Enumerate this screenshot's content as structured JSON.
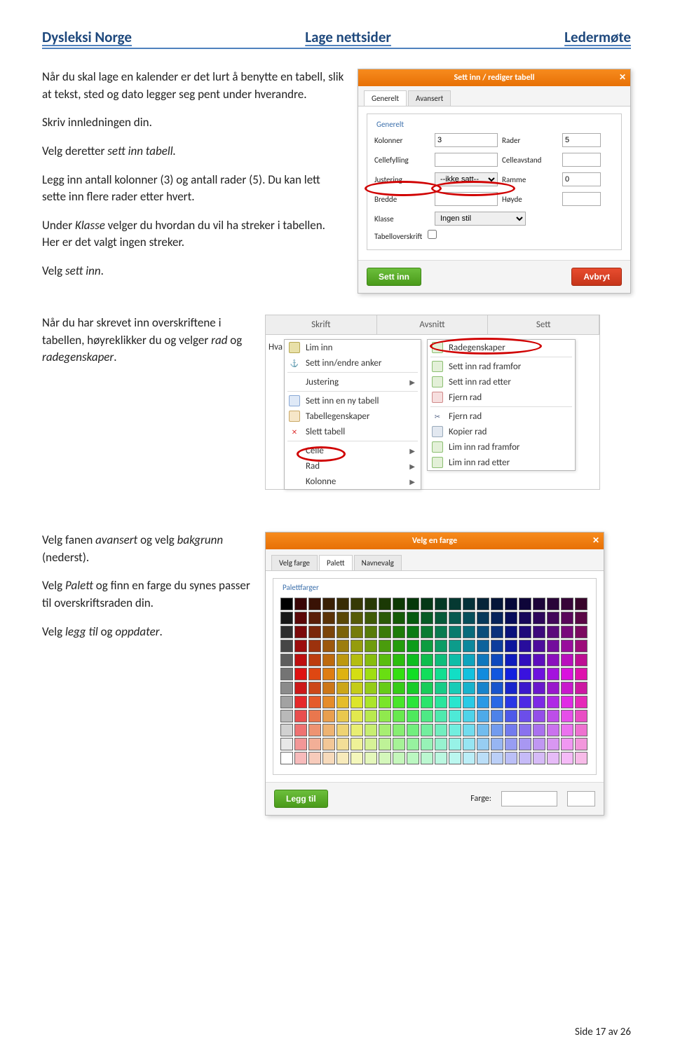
{
  "header": {
    "left": "Dysleksi Norge",
    "center": "Lage nettsider",
    "right": "Ledermøte"
  },
  "intro": {
    "p1": "Når du skal lage en kalender er det lurt å benytte en tabell, slik at tekst, sted og dato legger seg pent under hverandre.",
    "p2": "Skriv innledningen din.",
    "p3a": "Velg deretter ",
    "p3b": "sett inn tabell.",
    "p4": "Legg inn antall kolonner (3) og antall rader (5). Du kan lett sette inn flere rader etter hvert.",
    "p5a": "Under ",
    "p5b": "Klasse",
    "p5c": " velger du hvordan du vil ha streker i tabellen. Her er det valgt ingen streker.",
    "p6a": "Velg ",
    "p6b": "sett inn",
    "p6c": "."
  },
  "block2": {
    "p1a": "Når du har skrevet inn overskriftene i tabellen, høyreklikker du og velger ",
    "p1b": "rad",
    "p1c": " og ",
    "p1d": "radegenskaper",
    "p1e": "."
  },
  "block3": {
    "p1a": "Velg fanen ",
    "p1b": "avansert",
    "p1c": " og velg ",
    "p1d": "bakgrunn ",
    "p1e": "(nederst).",
    "p2a": "Velg ",
    "p2b": "Palett",
    "p2c": " og finn en farge du synes passer til overskriftsraden din.",
    "p3a": "Velg ",
    "p3b": "legg til",
    "p3c": " og ",
    "p3d": "oppdater",
    "p3e": "."
  },
  "dialog1": {
    "title": "Sett inn / rediger tabell",
    "tab_general": "Generelt",
    "tab_advanced": "Avansert",
    "legend": "Generelt",
    "labels": {
      "kolonner": "Kolonner",
      "rader": "Rader",
      "cellefylling": "Cellefylling",
      "celleavstand": "Celleavstand",
      "justering": "Justering",
      "ramme": "Ramme",
      "bredde": "Bredde",
      "hoyde": "Høyde",
      "klasse": "Klasse",
      "tabelloverskrift": "Tabelloverskrift"
    },
    "values": {
      "kolonner": "3",
      "rader": "5",
      "justering": "--ikke satt--",
      "ramme": "0",
      "klasse": "Ingen stil"
    },
    "btn_insert": "Sett inn",
    "btn_cancel": "Avbryt"
  },
  "shot2": {
    "tabs": {
      "skrift": "Skrift",
      "avsnitt": "Avsnitt",
      "sett": "Sett"
    },
    "hva": "Hva",
    "left": {
      "liminn": "Lim inn",
      "settanker": "Sett inn/endre anker",
      "justering": "Justering",
      "nytabell": "Sett inn en ny tabell",
      "tabellegenskaper": "Tabellegenskaper",
      "sletttabell": "Slett tabell",
      "celle": "Celle",
      "rad": "Rad",
      "kolonne": "Kolonne"
    },
    "right": {
      "radegenskaper": "Radegenskaper",
      "radframfor": "Sett inn rad framfor",
      "radetter": "Sett inn rad etter",
      "fjernrad": "Fjern rad",
      "fjernrad2": "Fjern rad",
      "kopierrad": "Kopier rad",
      "limframfor": "Lim inn rad framfor",
      "limetter": "Lim inn rad etter"
    }
  },
  "dialog3": {
    "title": "Velg en farge",
    "tab_velg": "Velg farge",
    "tab_palett": "Palett",
    "tab_navn": "Navnevalg",
    "legend": "Palettfarger",
    "btn_add": "Legg til",
    "farge_label": "Farge:"
  },
  "footer": "Side 17 av 26"
}
